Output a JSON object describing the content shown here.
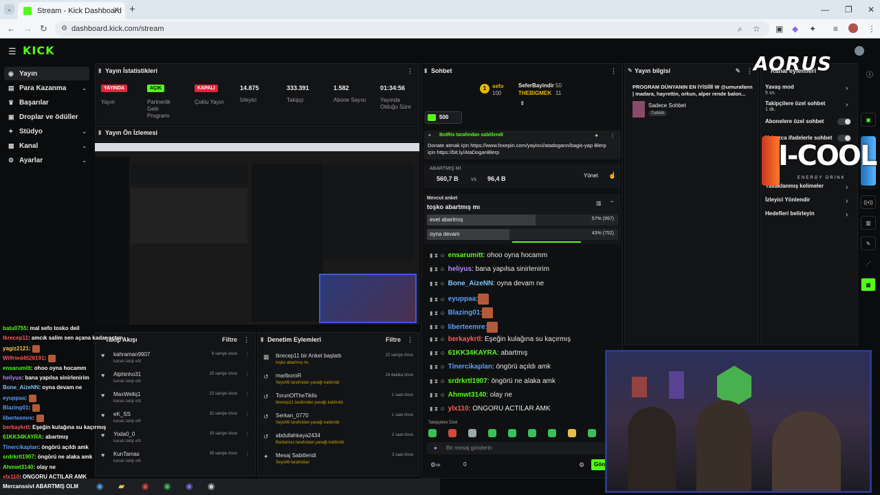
{
  "browser": {
    "tab_title": "Stream - Kick Dashboard",
    "url": "dashboard.kick.com/stream"
  },
  "app": {
    "logo": "KICK"
  },
  "sidebar": {
    "items": [
      {
        "label": "Yayın",
        "icon": "broadcast-icon"
      },
      {
        "label": "Para Kazanma",
        "icon": "money-icon"
      },
      {
        "label": "Başarılar",
        "icon": "trophy-icon"
      },
      {
        "label": "Droplar ve ödüller",
        "icon": "gift-icon"
      },
      {
        "label": "Stüdyo",
        "icon": "studio-icon"
      },
      {
        "label": "Kanal",
        "icon": "channel-icon"
      },
      {
        "label": "Ayarlar",
        "icon": "settings-icon"
      }
    ]
  },
  "stats": {
    "title": "Yayın İstatistikleri",
    "badges": [
      {
        "badge": "YAYINDA",
        "label": "Yayın",
        "color": "#e5243b"
      },
      {
        "badge": "AÇIK",
        "label": "Partnerlik Gelir Programı",
        "color": "#53fc18"
      },
      {
        "badge": "KAPALI",
        "label": "Çoklu Yayın",
        "color": "#e5243b"
      }
    ],
    "values": [
      {
        "value": "14.875",
        "label": "İzleyici"
      },
      {
        "value": "333.391",
        "label": "Takipçi"
      },
      {
        "value": "1.582",
        "label": "Abone Sayısı"
      },
      {
        "value": "01:34:56",
        "label": "Yayında Olduğu Süre"
      }
    ]
  },
  "preview": {
    "title": "Yayın Ön İzlemesi"
  },
  "follows": {
    "title": "Takip Akışı",
    "filter": "Filtre",
    "rows": [
      {
        "name": "kahraman9907",
        "sub": "kanalı takip etti",
        "time": "6 saniye önce"
      },
      {
        "name": "Alphinho31",
        "sub": "kanalı takip etti",
        "time": "20 saniye önce"
      },
      {
        "name": "MaxWellq1",
        "sub": "kanalı takip etti",
        "time": "22 saniye önce"
      },
      {
        "name": "eK_SS",
        "sub": "kanalı takip etti",
        "time": "32 saniye önce"
      },
      {
        "name": "Yoda0_0",
        "sub": "kanalı takip etti",
        "time": "33 saniye önce"
      },
      {
        "name": "KunTamas",
        "sub": "kanalı takip etti",
        "time": "35 saniye önce"
      }
    ]
  },
  "moderation": {
    "title": "Denetim Eylemleri",
    "filter": "Filtre",
    "rows": [
      {
        "name": "tkrecep11 bir Anket başlattı",
        "sub": "toşko abartmış mı",
        "time": "22 saniye önce"
      },
      {
        "name": "marlboroR",
        "sub": "Seyo06 tarafından yasağı kaldırıldı",
        "time": "24 dakika önce"
      },
      {
        "name": "TorunOfTheTiklis",
        "sub": "tkrecep11 tarafından yasağı kaldırıldı",
        "time": "1 saat önce"
      },
      {
        "name": "Serkan_0770",
        "sub": "Seyo06 tarafından yasağı kaldırıldı",
        "time": "1 saat önce"
      },
      {
        "name": "abdullahkaya2434",
        "sub": "Barbaross tarafından yasağı kaldırıldı",
        "time": "2 saat önce"
      },
      {
        "name": "Mesaj Sabitlendi",
        "sub": "Seyo06 tarafından",
        "time": "3 saat önce"
      }
    ]
  },
  "chat": {
    "title": "Sohbet",
    "leaderboard": [
      {
        "rank": "1",
        "name": "sefo",
        "amount": "100"
      },
      {
        "name": "SeferBayindir",
        "amount": "50"
      },
      {
        "name": "THEBIGMEK",
        "amount": "11"
      }
    ],
    "kicks": "500",
    "pinned": {
      "by": "BotRix tarafından sabitlendi",
      "text": "Donate atmak için https://www.foxepin.com/yayinci/atadogann/bagis-yap Blerp için https://bit.ly/AtaDoganBlerp"
    },
    "prediction": {
      "title": "ABARTMIŞ MI",
      "a": "560,7 B",
      "vs": "vs",
      "b": "96,4 B",
      "manage": "Yönet"
    },
    "poll": {
      "label": "Mevcut anket",
      "question": "toşko abartmış mı",
      "options": [
        {
          "text": "evet abartmış",
          "result": "57% (997)",
          "pct": 57
        },
        {
          "text": "oyna devam",
          "result": "43% (752)",
          "pct": 43
        }
      ]
    },
    "messages": [
      {
        "user": "ensarumitt",
        "color": "#53fc18",
        "text": ": ohoo oyna hocamm"
      },
      {
        "user": "heliyus",
        "color": "#b58cff",
        "text": ": bana yapılsa sinirlenirim"
      },
      {
        "user": "Bone_AizeNN",
        "color": "#7cc7ff",
        "text": ": oyna devam ne"
      },
      {
        "user": "eyuppaa",
        "color": "#5aa0ff",
        "text": ":"
      },
      {
        "user": "Blazing01",
        "color": "#5aa0ff",
        "text": ":"
      },
      {
        "user": "liberteemre",
        "color": "#5aa0ff",
        "text": ":"
      },
      {
        "user": "berkaykrtl",
        "color": "#ff5a5a",
        "text": ": Eşeğin kulağına su kaçırmış"
      },
      {
        "user": "61KK34KAYRA",
        "color": "#53fc18",
        "text": ": abartmış"
      },
      {
        "user": "Tinercikaplan",
        "color": "#5aa0ff",
        "text": ": öngörü açıldı amk"
      },
      {
        "user": "srdrkrtl1907",
        "color": "#53fc18",
        "text": ": öngörü ne alaka amk"
      },
      {
        "user": "Ahmwt3140",
        "color": "#53fc18",
        "text": ": olay ne"
      },
      {
        "user": "ylx110",
        "color": "#ff5a5a",
        "text": ": ONGORU ACTILAR AMK"
      }
    ],
    "emote_label": "Takipçilere Özel",
    "input_placeholder": "Bir mesaj gönderin",
    "counter": "0",
    "send": "Gönder"
  },
  "stream_info": {
    "title": "Yayın bilgisi",
    "stream_title": "PROGRAM DÜNYANIN EN İYİSİİİİ W @umurafann | madara, hayrettin, orkun, alper rende balon...",
    "category": "Sadece Sohbet",
    "tag": "Turkish"
  },
  "chat_settings": {
    "title": "Kanal eylemleri",
    "rows": [
      {
        "label": "Yavaş mod",
        "sub": "5 sn."
      },
      {
        "label": "Takipçilere özel sohbet",
        "sub": "1 dk."
      },
      {
        "label": "Abonelere özel sohbet"
      },
      {
        "label": "Yalnızca ifadelerle sohbet"
      },
      {
        "label": "Yasaklanmış kelimeler"
      },
      {
        "label": "İzleyici Yönlendir"
      },
      {
        "label": "Hedefleri belirleyin"
      }
    ]
  },
  "overlay_chat": [
    {
      "user": "batu0755",
      "text": ": mal sefo tosko deil",
      "color": "#53fc18"
    },
    {
      "user": "tkrecep11",
      "text": ": amcık salim sen açana kadar açtım",
      "color": "#ff5a5a"
    },
    {
      "user": "yagiz2121",
      "text": ":",
      "color": "#ffd04d"
    },
    {
      "user": "Wilfried4526191",
      "text": ":",
      "color": "#ff5a5a"
    },
    {
      "user": "ensarumitt",
      "text": ": ohoo oyna hocamm",
      "color": "#53fc18"
    },
    {
      "user": "heliyus",
      "text": ": bana yapılsa sinirlenirim",
      "color": "#b58cff"
    },
    {
      "user": "Bone_AizeNN",
      "text": ": oyna devam ne",
      "color": "#7cc7ff"
    },
    {
      "user": "eyuppaa",
      "text": ":",
      "color": "#5aa0ff"
    },
    {
      "user": "Blazing01",
      "text": ":",
      "color": "#5aa0ff"
    },
    {
      "user": "liberteemre",
      "text": ":",
      "color": "#5aa0ff"
    },
    {
      "user": "berkaykrtl",
      "text": ": Eşeğin kulağına su kaçırmış",
      "color": "#ff5a5a"
    },
    {
      "user": "61KK34KAYRA",
      "text": ": abartmış",
      "color": "#53fc18"
    },
    {
      "user": "Tinercikaplan",
      "text": ": öngörü açıldı amk",
      "color": "#5aa0ff"
    },
    {
      "user": "srdrkrtl1907",
      "text": ": öngörü ne alaka amk",
      "color": "#53fc18"
    },
    {
      "user": "Ahmwt3140",
      "text": ": olay ne",
      "color": "#53fc18"
    },
    {
      "user": "ylx110",
      "text": ": ONGORU ACTILAR AMK",
      "color": "#ff5a5a"
    }
  ],
  "brand_overlays": {
    "aorus": "AORUS",
    "cool": "I-COOL",
    "cool_sub": "ENERGY DRINK"
  },
  "taskbar": {
    "text": "Mercanssivl ABARTMIŞ OLM"
  }
}
